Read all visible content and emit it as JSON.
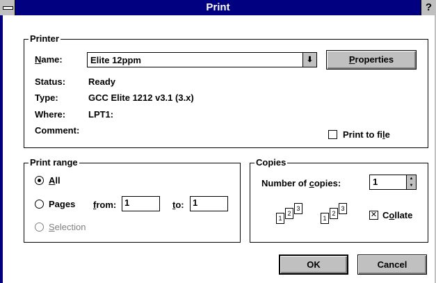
{
  "window": {
    "title": "Print",
    "help_label": "?"
  },
  "printer_group": {
    "legend": "Printer",
    "name_label_prefix": "",
    "name_label_ul": "N",
    "name_label_rest": "ame:",
    "name_value": "Elite 12ppm",
    "properties_label_ul": "P",
    "properties_label_rest": "roperties",
    "status_label": "Status:",
    "status_value": "Ready",
    "type_label": "Type:",
    "type_value": "GCC Elite 1212 v3.1 (3.x)",
    "where_label": "Where:",
    "where_value": "LPT1:",
    "comment_label": "Comment:",
    "print_to_file_prefix": "Print to fi",
    "print_to_file_ul": "l",
    "print_to_file_rest": "e",
    "print_to_file_checked": false
  },
  "print_range_group": {
    "legend": "Print range",
    "all_ul": "A",
    "all_rest": "ll",
    "pages_prefix": "Pa",
    "pages_ul": "g",
    "pages_rest": "es",
    "from_ul": "f",
    "from_rest": "rom:",
    "from_value": "1",
    "to_ul": "t",
    "to_rest": "o:",
    "to_value": "1",
    "selection_ul": "S",
    "selection_rest": "election",
    "selected": "All"
  },
  "copies_group": {
    "legend": "Copies",
    "num_prefix": "Number of ",
    "num_ul": "c",
    "num_rest": "opies:",
    "num_value": "1",
    "collate_prefix": "C",
    "collate_ul": "o",
    "collate_rest": "llate",
    "collate_checked": true,
    "page_numbers": [
      "1",
      "2",
      "3"
    ]
  },
  "buttons": {
    "ok": "OK",
    "cancel": "Cancel"
  }
}
